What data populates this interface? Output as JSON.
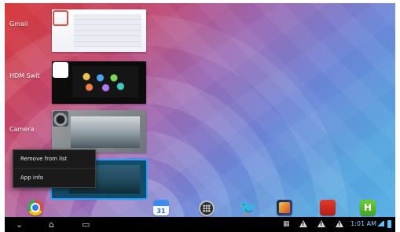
{
  "recent_apps": [
    {
      "label": "Gmail"
    },
    {
      "label": "HDM Swit"
    },
    {
      "label": "Camera"
    }
  ],
  "context_menu": {
    "items": [
      "Remove from list",
      "App info"
    ]
  },
  "dock": {
    "calendar_date": "31",
    "icons": [
      "chrome-icon",
      "calendar-icon",
      "apps-icon",
      "twitter-icon",
      "game-icon",
      "red-app-icon",
      "green-app-icon"
    ]
  },
  "status": {
    "time": "1:01 AM"
  },
  "colors": {
    "accent_blue": "#2aa1ff",
    "wallpaper_red": "#d83a3a",
    "wallpaper_blue": "#58b0e4"
  }
}
